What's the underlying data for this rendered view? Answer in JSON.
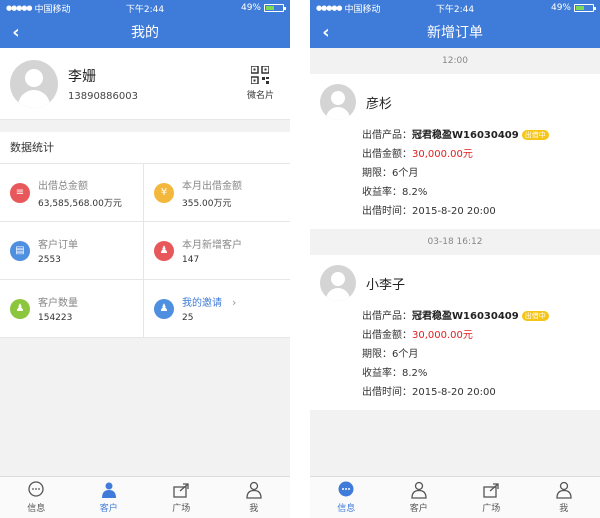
{
  "status": {
    "carrier": "中国移动",
    "time": "下午2:44",
    "battery": "49%",
    "battery_level": 0.49
  },
  "colors": {
    "brand": "#3f7cd9",
    "red": "#e02020",
    "badge": "#f5c518"
  },
  "left": {
    "title": "我的",
    "user": {
      "name": "李姗",
      "phone": "13890886003"
    },
    "qr_label": "微名片",
    "section_title": "数据统计",
    "stats": [
      {
        "label": "出借总金额",
        "value": "63,585,568.00万元",
        "icon": "coin-icon",
        "color": "#e8575a"
      },
      {
        "label": "本月出借金额",
        "value": "355.00万元",
        "icon": "yen-icon",
        "color": "#f3b73c"
      },
      {
        "label": "客户订单",
        "value": "2553",
        "icon": "clipboard-icon",
        "color": "#4f8fe0"
      },
      {
        "label": "本月新增客户",
        "value": "147",
        "icon": "user-add-icon",
        "color": "#e8575a"
      },
      {
        "label": "客户数量",
        "value": "154223",
        "icon": "users-icon",
        "color": "#8cc63f"
      },
      {
        "label": "我的邀请",
        "value": "25",
        "icon": "invite-icon",
        "color": "#4f8fe0"
      }
    ]
  },
  "right": {
    "title": "新增订单",
    "orders": [
      {
        "time": "12:00",
        "name": "彦杉",
        "product_label": "出借产品：",
        "product": "冠君稳盈W16030409",
        "badge": "出借中",
        "amount_label": "出借金额：",
        "amount": "30,000.00元",
        "term": "期限：6个月",
        "rate": "收益率：8.2%",
        "date": "出借时间：2015-8-20 20:00"
      },
      {
        "time": "03-18 16:12",
        "name": "小李子",
        "product_label": "出借产品：",
        "product": "冠君稳盈W16030409",
        "badge": "出借中",
        "amount_label": "出借金额：",
        "amount": "30,000.00元",
        "term": "期限：6个月",
        "rate": "收益率：8.2%",
        "date": "出借时间：2015-8-20 20:00"
      }
    ]
  },
  "tabs": [
    {
      "label": "信息",
      "icon": "chat-icon"
    },
    {
      "label": "客户",
      "icon": "client-icon"
    },
    {
      "label": "广场",
      "icon": "share-icon"
    },
    {
      "label": "我",
      "icon": "me-icon"
    }
  ],
  "active_tab": {
    "left": "客户",
    "right": "信息"
  }
}
